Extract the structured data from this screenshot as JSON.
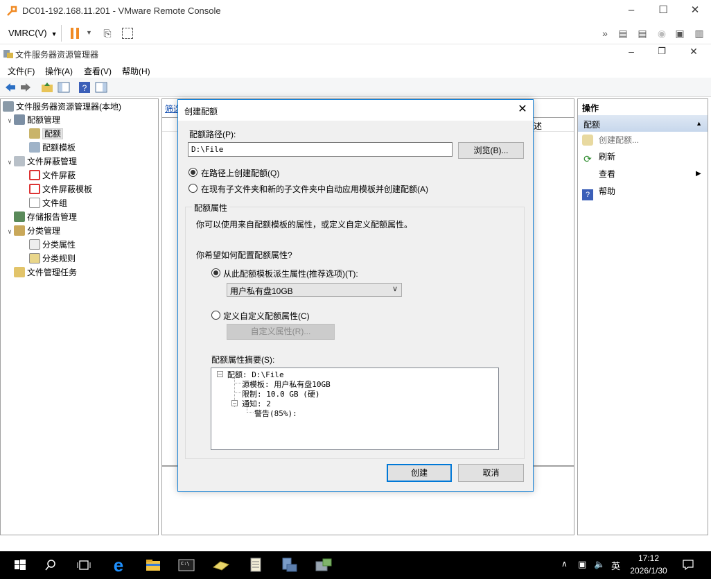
{
  "vmrc": {
    "window_title": "DC01-192.168.11.201 - VMware Remote Console",
    "menu_label": "VMRC(V)"
  },
  "mmc": {
    "window_title": "文件服务器资源管理器",
    "menu": [
      "文件(F)",
      "操作(A)",
      "查看(V)",
      "帮助(H)"
    ]
  },
  "tree": {
    "root": "文件服务器资源管理器(本地)",
    "items": [
      {
        "label": "配额管理",
        "level": 1,
        "expander": "open"
      },
      {
        "label": "配额",
        "level": 2,
        "selected": true
      },
      {
        "label": "配额模板",
        "level": 2
      },
      {
        "label": "文件屏蔽管理",
        "level": 1,
        "expander": "open"
      },
      {
        "label": "文件屏蔽",
        "level": 2
      },
      {
        "label": "文件屏蔽模板",
        "level": 2
      },
      {
        "label": "文件组",
        "level": 2
      },
      {
        "label": "存储报告管理",
        "level": 1
      },
      {
        "label": "分类管理",
        "level": 1,
        "expander": "open"
      },
      {
        "label": "分类属性",
        "level": 2
      },
      {
        "label": "分类规则",
        "level": 2
      },
      {
        "label": "文件管理任务",
        "level": 1
      }
    ]
  },
  "center": {
    "filter_link": "筛选",
    "col_header_fragment": "述"
  },
  "actions": {
    "title": "操作",
    "group": "配额",
    "items": [
      {
        "label": "创建配额...",
        "icon": "create-quota-icon",
        "dimmed": true
      },
      {
        "label": "刷新",
        "icon": "refresh-icon"
      },
      {
        "label": "查看",
        "icon": "none",
        "submenu": true
      },
      {
        "label": "帮助",
        "icon": "help-icon"
      }
    ]
  },
  "dialog": {
    "title": "创建配额",
    "path_label": "配额路径(P):",
    "path_value": "D:\\File",
    "browse_label": "浏览(B)...",
    "radio_create_on_path": "在路径上创建配额(Q)",
    "radio_auto_apply": "在现有子文件夹和新的子文件夹中自动应用模板并创建配额(A)",
    "group_label": "配额属性",
    "group_desc": "你可以使用来自配额模板的属性，或定义自定义配额属性。",
    "question": "你希望如何配置配额属性?",
    "radio_derive": "从此配额模板派生属性(推荐选项)(T):",
    "template_selected": "用户私有盘10GB",
    "radio_custom": "定义自定义配额属性(C)",
    "custom_button": "自定义属性(R)...",
    "summary_label": "配额属性摘要(S):",
    "summary": {
      "quota": "配额: D:\\File",
      "source": "源模板: 用户私有盘10GB",
      "limit": "限制: 10.0 GB (硬)",
      "notify": "通知: 2",
      "warning": "警告(85%):"
    },
    "create_button": "创建",
    "cancel_button": "取消"
  },
  "taskbar": {
    "time": "17:12",
    "date": "2026/1/30",
    "ime": "英"
  },
  "colors": {
    "accent": "#0078d7",
    "pause": "#f08a24",
    "taskbar": "#000000"
  }
}
